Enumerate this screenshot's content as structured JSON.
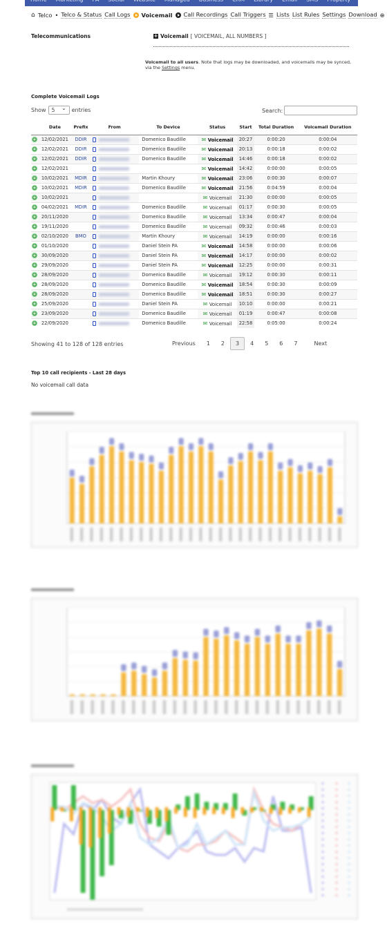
{
  "top_nav": [
    "Home",
    "Marketing",
    "PA",
    "Social",
    "Website",
    "Managed",
    "Business",
    "CRM",
    "Library",
    "Email",
    "SMS",
    "Property"
  ],
  "sub_nav": {
    "home": "Telco",
    "items": [
      "Telco & Status",
      "Call Logs",
      "Voicemail",
      "Call Recordings",
      "Call Triggers",
      "Lists",
      "List Rules",
      "Settings",
      "Download"
    ],
    "active": "Voicemail"
  },
  "section_title": "Telecommunications",
  "voicemail_header": {
    "title": "Voicemail",
    "scope": "[ VOICEMAIL, ALL NUMBERS ]"
  },
  "description": {
    "bold": "Voicemail to all users",
    "text": ". Note that logs may be downloaded, and voicemails may be synced, via the ",
    "link": "Settings",
    "tail": " menu."
  },
  "logs": {
    "title": "Complete Voicemail Logs",
    "show_label": "Show",
    "entries_value": "5",
    "entries_label": "entries",
    "search_label": "Search:",
    "search_value": "",
    "columns": [
      "",
      "Date",
      "Prefix",
      "From",
      "To Device",
      "Status",
      "Start",
      "Total Duration",
      "Voicemail Duration"
    ],
    "rows": [
      [
        "12/02/2021",
        "DDIR",
        "Domenico Baudille",
        "Voicemail",
        true,
        "20:27",
        "0:00:20",
        "0:00:04"
      ],
      [
        "12/02/2021",
        "DDIR",
        "Domenico Baudille",
        "Voicemail",
        true,
        "20:13",
        "0:00:18",
        "0:00:02"
      ],
      [
        "12/02/2021",
        "DDIR",
        "Domenico Baudille",
        "Voicemail",
        true,
        "14:46",
        "0:00:18",
        "0:00:02"
      ],
      [
        "12/02/2021",
        "",
        "",
        "Voicemail",
        true,
        "14:42",
        "0:00:00",
        "0:00:05"
      ],
      [
        "10/02/2021",
        "MDIR",
        "Martin Khoury",
        "Voicemail",
        true,
        "23:06",
        "0:00:30",
        "0:00:07"
      ],
      [
        "10/02/2021",
        "MDIR",
        "Domenico Baudille",
        "Voicemail",
        true,
        "21:56",
        "0:04:59",
        "0:00:04"
      ],
      [
        "10/02/2021",
        "",
        "",
        "Voicemail",
        false,
        "21:30",
        "0:00:00",
        "0:00:05"
      ],
      [
        "04/02/2021",
        "MDIR",
        "Domenico Baudille",
        "Voicemail",
        false,
        "01:17",
        "0:00:30",
        "0:00:05"
      ],
      [
        "20/11/2020",
        "",
        "Domenico Baudille",
        "Voicemail",
        false,
        "13:34",
        "0:00:47",
        "0:00:04"
      ],
      [
        "19/11/2020",
        "",
        "Domenico Baudille",
        "Voicemail",
        false,
        "09:32",
        "0:00:46",
        "0:00:03"
      ],
      [
        "02/10/2020",
        "BMO",
        "Martin Khoury",
        "Voicemail",
        false,
        "14:19",
        "0:00:00",
        "0:00:16"
      ],
      [
        "01/10/2020",
        "",
        "Daniel Stein PA",
        "Voicemail",
        true,
        "14:58",
        "0:00:00",
        "0:00:06"
      ],
      [
        "30/09/2020",
        "",
        "Daniel Stein PA",
        "Voicemail",
        true,
        "14:17",
        "0:00:00",
        "0:00:02"
      ],
      [
        "29/09/2020",
        "",
        "Daniel Stein PA",
        "Voicemail",
        true,
        "12:25",
        "0:00:00",
        "0:00:31"
      ],
      [
        "28/09/2020",
        "",
        "Domenico Baudille",
        "Voicemail",
        false,
        "19:12",
        "0:00:30",
        "0:00:11"
      ],
      [
        "28/09/2020",
        "",
        "Domenico Baudille",
        "Voicemail",
        true,
        "18:54",
        "0:00:30",
        "0:00:09"
      ],
      [
        "28/09/2020",
        "",
        "Domenico Baudille",
        "Voicemail",
        true,
        "18:51",
        "0:00:30",
        "0:00:27"
      ],
      [
        "25/09/2020",
        "",
        "Daniel Stein PA",
        "Voicemail",
        false,
        "10:10",
        "0:00:00",
        "0:00:21"
      ],
      [
        "23/09/2020",
        "",
        "Domenico Baudille",
        "Voicemail",
        false,
        "01:19",
        "0:00:47",
        "0:00:08"
      ],
      [
        "22/09/2020",
        "",
        "Domenico Baudille",
        "Voicemail",
        false,
        "22:58",
        "0:05:00",
        "0:00:24"
      ]
    ],
    "info": "Showing 41 to 128 of 128 entries",
    "pagination": {
      "previous": "Previous",
      "pages": [
        "1",
        "2",
        "3",
        "4",
        "5",
        "6",
        "7"
      ],
      "current": "3",
      "next": "Next"
    }
  },
  "top10": {
    "title": "Top 10 call recipients - Last 28 days",
    "empty": "No voicemail call data"
  },
  "colors": {
    "nav": "#3d5ba8",
    "accent": "#f5a623",
    "bar_main": "#f5b942",
    "bar_top": "#9aa0d8",
    "green": "#3ea04a"
  },
  "chart_data": [
    {
      "type": "bar",
      "stacked": true,
      "relative_values": [
        0.52,
        0.45,
        0.65,
        0.78,
        0.88,
        0.82,
        0.72,
        0.7,
        0.68,
        0.6,
        0.78,
        0.88,
        0.82,
        0.88,
        0.82,
        0.5,
        0.66,
        0.71,
        0.82,
        0.72,
        0.82,
        0.6,
        0.64,
        0.57,
        0.6,
        0.56,
        0.64,
        0.08
      ]
    },
    {
      "type": "bar",
      "stacked": true,
      "relative_values": [
        0.02,
        0.02,
        0.02,
        0.02,
        0.02,
        0.28,
        0.3,
        0.26,
        0.22,
        0.3,
        0.45,
        0.43,
        0.42,
        0.7,
        0.68,
        0.72,
        0.66,
        0.62,
        0.7,
        0.62,
        0.74,
        0.62,
        0.62,
        0.78,
        0.8,
        0.74,
        0.32
      ]
    },
    {
      "type": "bar",
      "relative_values": [
        0.18,
        0,
        0.18,
        -0.6,
        -0.65,
        -0.48,
        -0.4,
        -0.06,
        -0.1,
        0,
        -0.1,
        -0.12,
        -0.18,
        0.04,
        0.1,
        0.12,
        0.06,
        0.05,
        0.05,
        0.12,
        -0.04,
        0.02,
        0,
        0.04,
        0.06,
        0.04,
        0.02,
        0.1
      ]
    }
  ]
}
